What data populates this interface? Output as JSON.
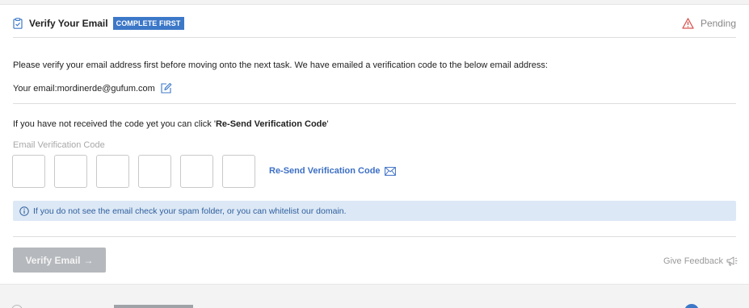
{
  "task": {
    "title": "Verify Your Email",
    "badge": "COMPLETE FIRST",
    "status": "Pending"
  },
  "intro_text": "Please verify your email address first before moving onto the next task. We have emailed a verification code to the below email address:",
  "email_line": {
    "label": "Your email: ",
    "value": "mordinerde@gufum.com"
  },
  "resend_note": {
    "prefix": "If you have not received the code yet you can click '",
    "link_name": "Re-Send Verification Code",
    "suffix": "'"
  },
  "code": {
    "label": "Email Verification Code",
    "digits": [
      "",
      "",
      "",
      "",
      "",
      ""
    ]
  },
  "resend_link": "Re-Send Verification Code",
  "info_message": "If you do not see the email check your spam folder, or you can whitelist our domain.",
  "buttons": {
    "verify": "Verify Email",
    "verify_arrow": "→",
    "feedback": "Give Feedback"
  },
  "colors": {
    "accent": "#3c78c8",
    "warning": "#d9534f",
    "info_bg": "#dce8f5",
    "disabled_btn": "#b5b8bc"
  },
  "icons": {
    "clipboard": "clipboard-check-icon",
    "warning": "warning-triangle-icon",
    "edit": "edit-icon",
    "mail": "mail-icon",
    "info": "info-circle-icon",
    "feedback": "megaphone-icon"
  }
}
